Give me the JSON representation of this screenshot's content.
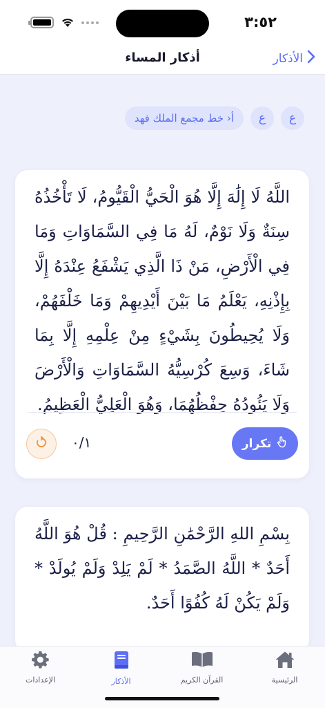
{
  "status": {
    "time": "٣:٥٢"
  },
  "nav": {
    "title": "أذكار المساء",
    "back_label": "الأذكار"
  },
  "font_chips": {
    "size_large": "ع",
    "size_small": "ع",
    "font_label": "أ‹ خط مجمع الملك فهد"
  },
  "cards": [
    {
      "text": "اللَّهُ لَا إِلَٰهَ إِلَّا هُوَ الْحَيُّ الْقَيُّومُ، لَا تَأْخُذُهُ سِنَةٌ وَلَا نَوْمٌ، لَهُ مَا فِي السَّمَاوَاتِ وَمَا فِي الْأَرْضِ، مَنْ ذَا الَّذِي يَشْفَعُ عِنْدَهُ إِلَّا بِإِذْنِهِ، يَعْلَمُ مَا بَيْنَ أَيْدِيهِمْ وَمَا خَلْفَهُمْ، وَلَا يُحِيطُونَ بِشَيْءٍ مِنْ عِلْمِهِ إِلَّا بِمَا شَاءَ، وَسِعَ كُرْسِيُّهُ السَّمَاوَاتِ وَالْأَرْضَ وَلَا يَئُودُهُ حِفْظُهُمَا، وَهُوَ الْعَلِيُّ الْعَظِيمُ.",
      "repeat_label": "تكرار",
      "counter": "٠/١"
    },
    {
      "text": "بِسْمِ اللهِ الرَّحْمَٰنِ الرَّحِيمِ : قُلْ هُوَ اللَّهُ أَحَدٌ * اللَّهُ الصَّمَدُ * لَمْ يَلِدْ وَلَمْ يُولَدْ * وَلَمْ يَكُنْ لَهُ كُفُوًا أَحَدٌ."
    }
  ],
  "tabs": [
    {
      "label": "الرئيسية",
      "icon": "home-icon"
    },
    {
      "label": "القرآن الكريم",
      "icon": "book-open-icon"
    },
    {
      "label": "الأذكار",
      "icon": "book-icon",
      "active": true
    },
    {
      "label": "الإعدادات",
      "icon": "gear-icon"
    }
  ],
  "colors": {
    "accent": "#5b6ef5",
    "background": "#eef0fb",
    "reset_orange": "#f0923a"
  }
}
